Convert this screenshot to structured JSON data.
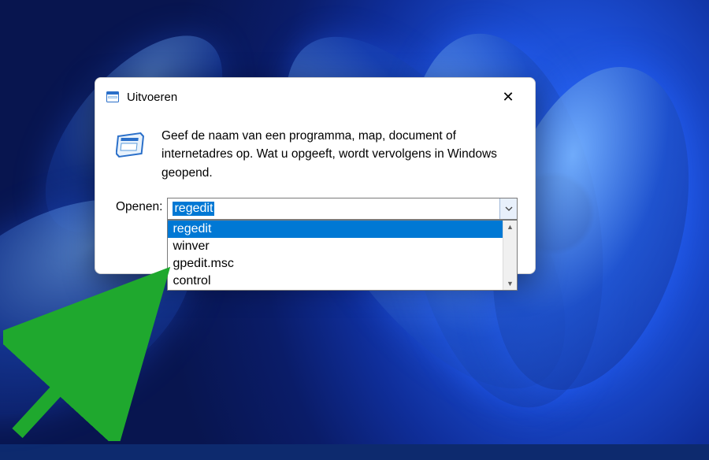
{
  "dialog": {
    "title": "Uitvoeren",
    "description": "Geef de naam van een programma, map, document of internetadres op. Wat u opgeeft, wordt vervolgens in Windows geopend.",
    "open_label": "Openen:",
    "input_value": "regedit",
    "dropdown_items": [
      {
        "label": "regedit",
        "selected": true
      },
      {
        "label": "winver",
        "selected": false
      },
      {
        "label": "gpedit.msc",
        "selected": false
      },
      {
        "label": "control",
        "selected": false
      }
    ]
  },
  "icons": {
    "title_icon": "run-dialog-icon",
    "main_icon": "run-dialog-icon",
    "close": "✕"
  },
  "colors": {
    "selection": "#0078d4",
    "arrow": "#1fa82e"
  }
}
